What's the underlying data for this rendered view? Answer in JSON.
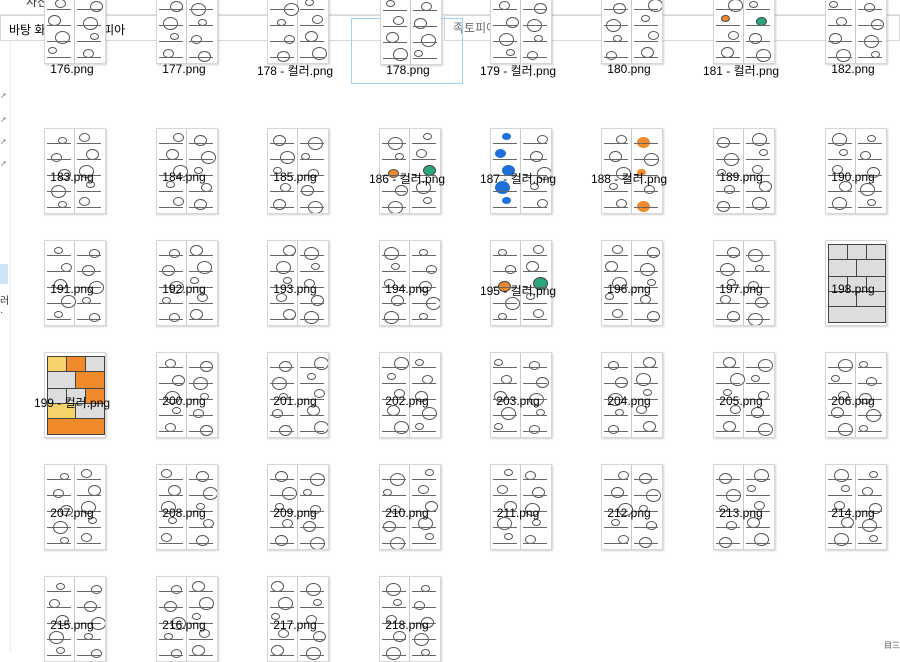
{
  "window": {
    "title_fragment": "사진 도구"
  },
  "address": {
    "crumbs": [
      "바탕 화면",
      "족토피아"
    ],
    "separator": "›",
    "dropdown_icon": "chevron-down-icon",
    "refresh_icon": "refresh-icon"
  },
  "search": {
    "placeholder": "족토피아 검색"
  },
  "nav": {
    "fragment": "러·"
  },
  "files": [
    {
      "name": "176.png",
      "kind": "bw"
    },
    {
      "name": "177.png",
      "kind": "bw"
    },
    {
      "name": "178 - 컬러.png",
      "kind": "bw"
    },
    {
      "name": "178.png",
      "kind": "bw",
      "selected": true
    },
    {
      "name": "179 - 컬러.png",
      "kind": "bw"
    },
    {
      "name": "180.png",
      "kind": "bw"
    },
    {
      "name": "181 - 컬러.png",
      "kind": "color"
    },
    {
      "name": "182.png",
      "kind": "bw"
    },
    {
      "name": "183.png",
      "kind": "bw"
    },
    {
      "name": "184.png",
      "kind": "bw"
    },
    {
      "name": "185.png",
      "kind": "bw"
    },
    {
      "name": "186 - 컬러.png",
      "kind": "color"
    },
    {
      "name": "187 - 컬러.png",
      "kind": "blue"
    },
    {
      "name": "188 - 컬러.png",
      "kind": "orange"
    },
    {
      "name": "189.png",
      "kind": "bw"
    },
    {
      "name": "190.png",
      "kind": "bw"
    },
    {
      "name": "191.png",
      "kind": "bw"
    },
    {
      "name": "192.png",
      "kind": "bw"
    },
    {
      "name": "193.png",
      "kind": "bw"
    },
    {
      "name": "194.png",
      "kind": "bw"
    },
    {
      "name": "195 - 컬러.png",
      "kind": "color"
    },
    {
      "name": "196.png",
      "kind": "bw"
    },
    {
      "name": "197.png",
      "kind": "bw"
    },
    {
      "name": "198.png",
      "kind": "grid"
    },
    {
      "name": "199 - 컬러.png",
      "kind": "gridcolor"
    },
    {
      "name": "200.png",
      "kind": "bw"
    },
    {
      "name": "201.png",
      "kind": "bw"
    },
    {
      "name": "202.png",
      "kind": "bw"
    },
    {
      "name": "203.png",
      "kind": "bw"
    },
    {
      "name": "204.png",
      "kind": "bw"
    },
    {
      "name": "205.png",
      "kind": "bw"
    },
    {
      "name": "206.png",
      "kind": "bw"
    },
    {
      "name": "207.png",
      "kind": "bw"
    },
    {
      "name": "208.png",
      "kind": "bw"
    },
    {
      "name": "209.png",
      "kind": "bw"
    },
    {
      "name": "210.png",
      "kind": "bw"
    },
    {
      "name": "211.png",
      "kind": "bw"
    },
    {
      "name": "212.png",
      "kind": "bw"
    },
    {
      "name": "213.png",
      "kind": "bw"
    },
    {
      "name": "214.png",
      "kind": "bw"
    },
    {
      "name": "215.png",
      "kind": "bw"
    },
    {
      "name": "216.png",
      "kind": "bw"
    },
    {
      "name": "217.png",
      "kind": "bw"
    },
    {
      "name": "218.png",
      "kind": "bw"
    }
  ],
  "colors": {
    "selection_border": "#99d1ff",
    "blue_hair": "#1e6fd9",
    "orange_hair": "#f08a2a",
    "teal": "#2aa67a"
  },
  "status": {
    "corner_fragment": "目三"
  }
}
